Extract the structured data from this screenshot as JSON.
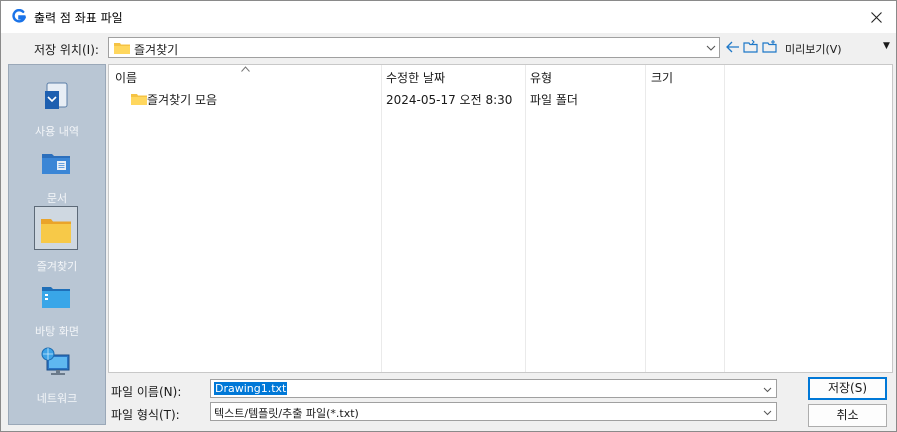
{
  "window": {
    "title": "출력 점 좌표 파일",
    "close_label": "×"
  },
  "location": {
    "label": "저장 위치(I):",
    "value": "즐겨찾기"
  },
  "toolbar": {
    "preview_label": "미리보기(V)",
    "preview_arrow": "▼"
  },
  "places": [
    {
      "label": "사용 내역",
      "icon": "history-icon"
    },
    {
      "label": "문서",
      "icon": "documents-icon"
    },
    {
      "label": "즐겨찾기",
      "icon": "favorites-folder-icon"
    },
    {
      "label": "바탕 화면",
      "icon": "desktop-icon"
    },
    {
      "label": "네트워크",
      "icon": "network-icon"
    }
  ],
  "columns": [
    "이름",
    "수정한 날짜",
    "유형",
    "크기"
  ],
  "rows": [
    {
      "name": "즐겨찾기 모음",
      "modified": "2024-05-17 오전 8:30",
      "type": "파일 폴더",
      "size": ""
    }
  ],
  "filename": {
    "label": "파일 이름(N):",
    "value": "Drawing1.txt"
  },
  "filetype": {
    "label": "파일 형식(T):",
    "value": "텍스트/템플릿/추출 파일(*.txt)"
  },
  "buttons": {
    "save": "저장(S)",
    "cancel": "취소"
  },
  "colors": {
    "accent": "#0078d7",
    "sidebar": "#b9c6d4",
    "folder": "#f5c344"
  }
}
